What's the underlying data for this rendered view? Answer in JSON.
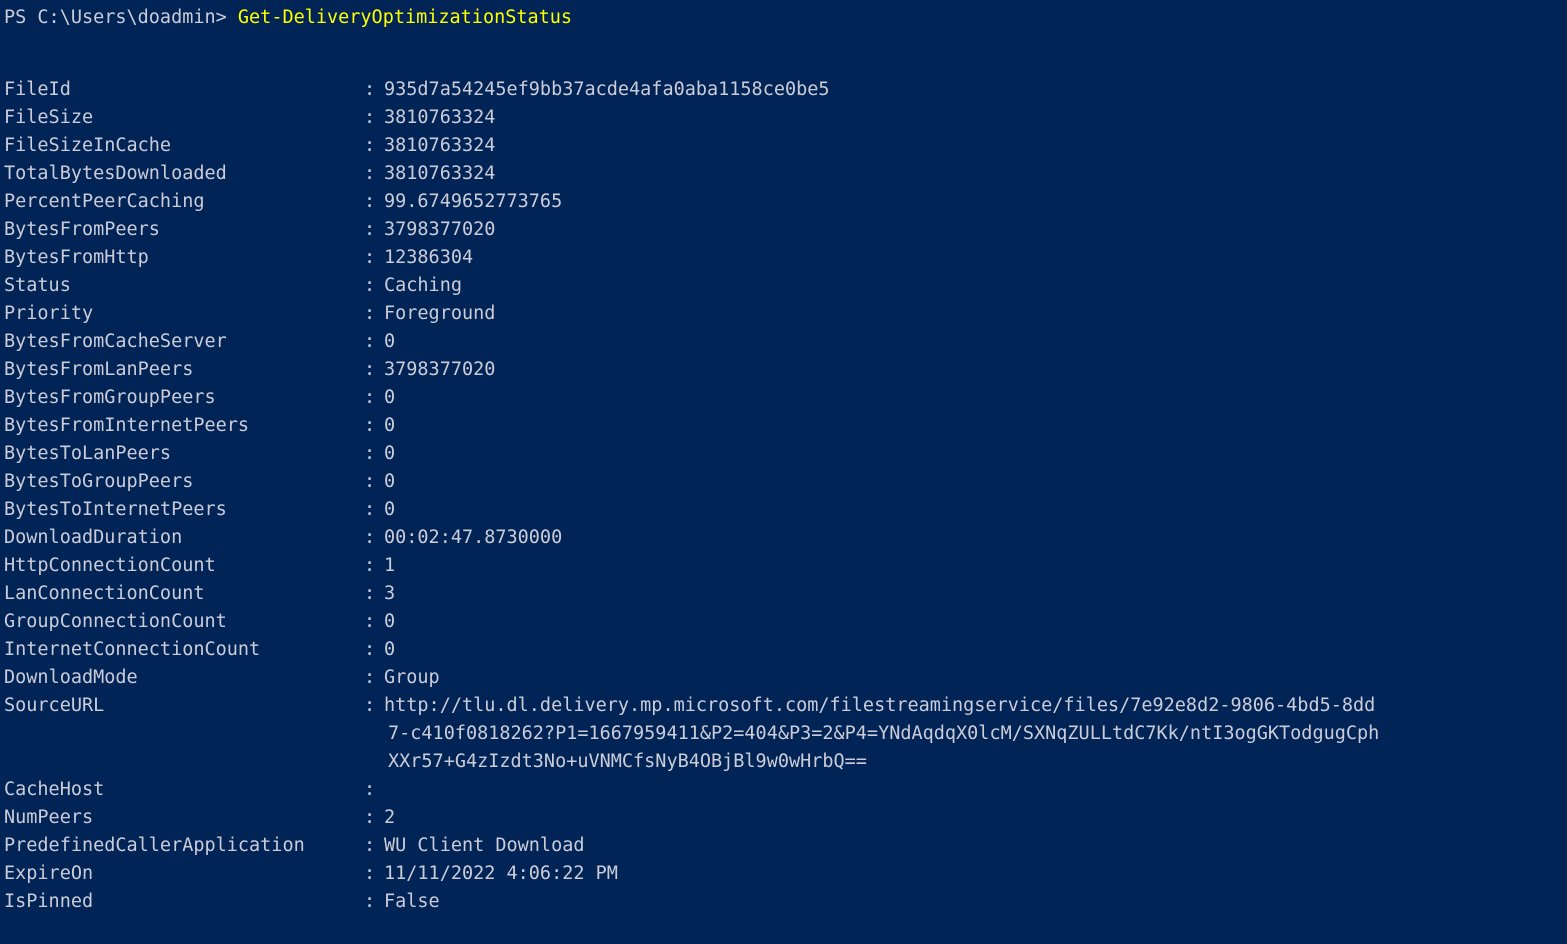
{
  "terminal": {
    "background_color": "#012456",
    "foreground_color": "#ccccd8",
    "command_color": "#ffff00",
    "prompt": "PS C:\\Users\\doadmin> ",
    "command": "Get-DeliveryOptimizationStatus"
  },
  "properties": [
    {
      "key": "FileId",
      "value": "935d7a54245ef9bb37acde4afa0aba1158ce0be5"
    },
    {
      "key": "FileSize",
      "value": "3810763324"
    },
    {
      "key": "FileSizeInCache",
      "value": "3810763324"
    },
    {
      "key": "TotalBytesDownloaded",
      "value": "3810763324"
    },
    {
      "key": "PercentPeerCaching",
      "value": "99.6749652773765"
    },
    {
      "key": "BytesFromPeers",
      "value": "3798377020"
    },
    {
      "key": "BytesFromHttp",
      "value": "12386304"
    },
    {
      "key": "Status",
      "value": "Caching"
    },
    {
      "key": "Priority",
      "value": "Foreground"
    },
    {
      "key": "BytesFromCacheServer",
      "value": "0"
    },
    {
      "key": "BytesFromLanPeers",
      "value": "3798377020"
    },
    {
      "key": "BytesFromGroupPeers",
      "value": "0"
    },
    {
      "key": "BytesFromInternetPeers",
      "value": "0"
    },
    {
      "key": "BytesToLanPeers",
      "value": "0"
    },
    {
      "key": "BytesToGroupPeers",
      "value": "0"
    },
    {
      "key": "BytesToInternetPeers",
      "value": "0"
    },
    {
      "key": "DownloadDuration",
      "value": "00:02:47.8730000"
    },
    {
      "key": "HttpConnectionCount",
      "value": "1"
    },
    {
      "key": "LanConnectionCount",
      "value": "3"
    },
    {
      "key": "GroupConnectionCount",
      "value": "0"
    },
    {
      "key": "InternetConnectionCount",
      "value": "0"
    },
    {
      "key": "DownloadMode",
      "value": "Group"
    }
  ],
  "source_url": {
    "key": "SourceURL",
    "line1": "http://tlu.dl.delivery.mp.microsoft.com/filestreamingservice/files/7e92e8d2-9806-4bd5-8dd",
    "line2": "7-c410f0818262?P1=1667959411&P2=404&P3=2&P4=YNdAqdqX0lcM/SXNqZULLtdC7Kk/ntI3ogGKTodgugCph",
    "line3": "XXr57+G4zIzdt3No+uVNMCfsNyB4OBjBl9w0wHrbQ=="
  },
  "properties_tail": [
    {
      "key": "CacheHost",
      "value": ""
    },
    {
      "key": "NumPeers",
      "value": "2"
    },
    {
      "key": "PredefinedCallerApplication",
      "value": "WU Client Download"
    },
    {
      "key": "ExpireOn",
      "value": "11/11/2022 4:06:22 PM"
    },
    {
      "key": "IsPinned",
      "value": "False"
    }
  ]
}
